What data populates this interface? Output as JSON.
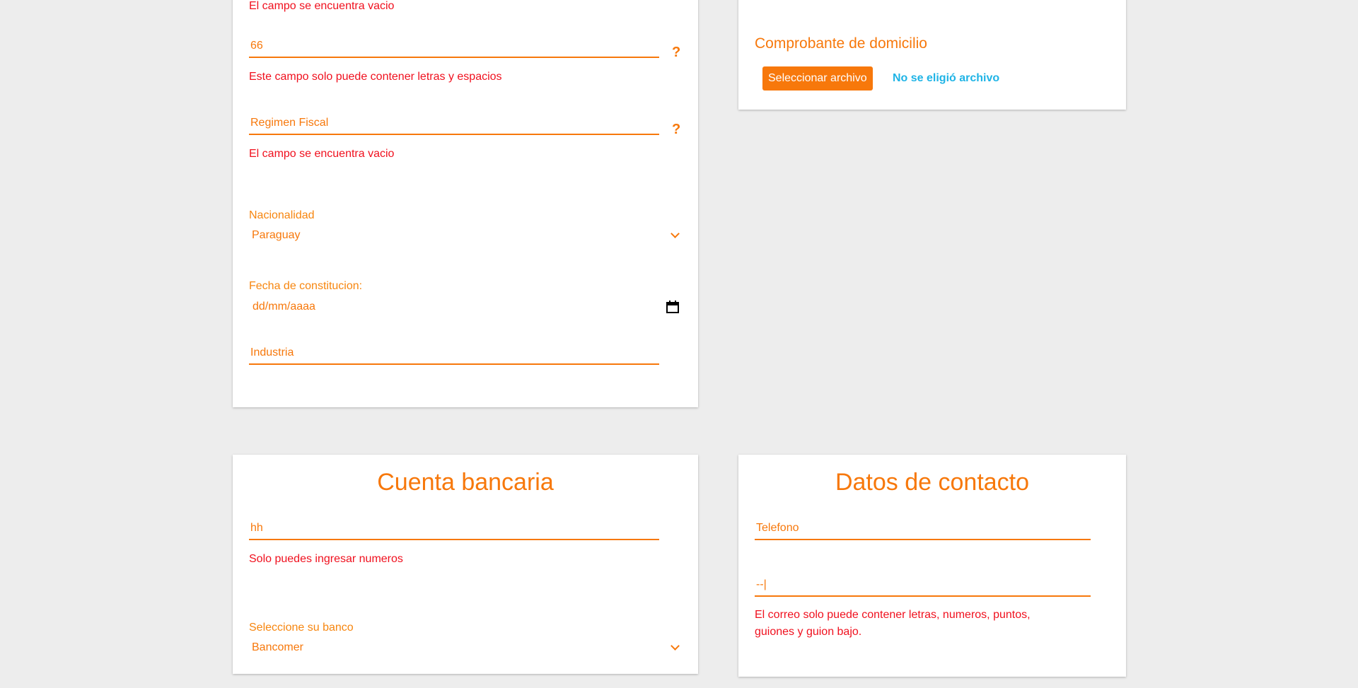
{
  "form_card": {
    "error_top": "El campo se encuentra vacio",
    "name_field": {
      "value": "66",
      "error": "Este campo solo puede contener letras y espacios",
      "help": "?"
    },
    "regimen_field": {
      "placeholder": "Regimen Fiscal",
      "error": "El campo se encuentra vacio",
      "help": "?"
    },
    "nacionalidad": {
      "label": "Nacionalidad",
      "value": "Paraguay"
    },
    "fecha": {
      "label": "Fecha de constitucion:",
      "placeholder": "dd/mm/aaaa"
    },
    "industria": {
      "placeholder": "Industria"
    }
  },
  "documents_card": {
    "label": "Comprobante de domicilio",
    "button": "Seleccionar archivo",
    "status": "No se eligió archivo"
  },
  "bank_card": {
    "title": "Cuenta bancaria",
    "account_field": {
      "value": "hh",
      "error": "Solo puedes ingresar numeros"
    },
    "bank_select": {
      "label": "Seleccione su banco",
      "value": "Bancomer"
    }
  },
  "contact_card": {
    "title": "Datos de contacto",
    "phone": {
      "placeholder": "Telefono"
    },
    "email": {
      "value": "--|",
      "error_line1": "El correo solo puede contener letras, numeros, puntos,",
      "error_line2": "guiones y guion bajo."
    }
  }
}
